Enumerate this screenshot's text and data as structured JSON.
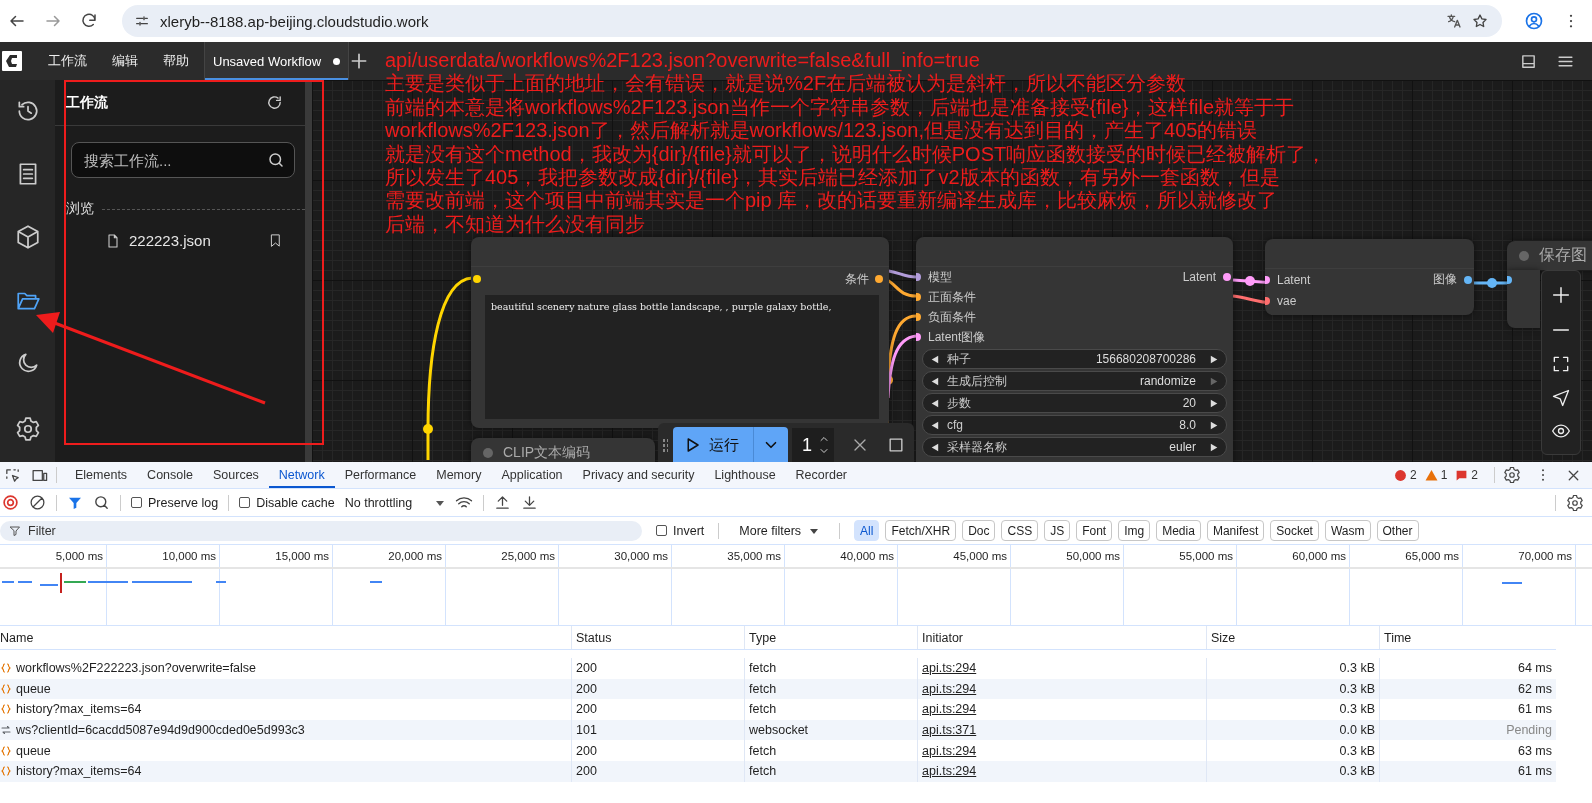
{
  "browser": {
    "url": "xleryb--8188.ap-beijing.cloudstudio.work"
  },
  "menubar": {
    "menus": [
      "工作流",
      "编辑",
      "帮助"
    ],
    "tabs": [
      {
        "label": "Unsaved Workflow",
        "selected": true,
        "unsaved": true
      }
    ]
  },
  "side_nav": [
    {
      "kind": "history",
      "selected": false
    },
    {
      "kind": "queue",
      "selected": false
    },
    {
      "kind": "models",
      "selected": false
    },
    {
      "kind": "workflows",
      "selected": true
    },
    {
      "kind": "theme",
      "selected": false
    },
    {
      "kind": "settings",
      "selected": false
    }
  ],
  "sidebar": {
    "title": "工作流",
    "search": {
      "placeholder": "搜索工作流..."
    },
    "section": "浏览",
    "files": [
      {
        "name": "222223.json"
      }
    ]
  },
  "annotation": {
    "lines": [
      "api/userdata/workflows%2F123.json?overwrite=false&full_info=true",
      "主要是类似于上面的地址，会有错误，就是说%2F在后端被认为是斜杆，所以不能区分参数",
      "前端的本意是将workflows%2F123.json当作一个字符串参数，后端也是准备接受{file}，这样file就等于于",
      "workflows%2F123.json了，然后解析就是workflows/123.json,但是没有达到目的，产生了405的错误",
      "就是没有这个method，我改为{dir}/{file}就可以了，说明什么时候POST响应函数接受的时候已经被解析了，",
      "所以发生了405，我把参数改成{dir}/{file}，其实后端已经添加了v2版本的函数，有另外一套函数，但是",
      "需要改前端，这个项目中前端其实是一个pip 库，改的话要重新编译生成库，比较麻烦，所以就修改了",
      "后端，不知道为什么没有同步"
    ]
  },
  "nodes": {
    "clip_encode": {
      "inputs": [
        {
          "color": "#ffd500"
        }
      ],
      "output": {
        "label": "条件",
        "color": "#ffa931"
      },
      "prompt": "beautiful scenery nature glass bottle landscape, , purple galaxy bottle,"
    },
    "clip_encode_2": {
      "title": "CLIP文本编码"
    },
    "ksampler": {
      "inputs": [
        {
          "label": "模型",
          "color": "#b39ddb"
        },
        {
          "label": "正面条件",
          "color": "#ffa931"
        },
        {
          "label": "负面条件",
          "color": "#ffa931"
        },
        {
          "label": "Latent图像",
          "color": "#ff9cf9"
        }
      ],
      "output": {
        "label": "Latent",
        "color": "#ff9cf9"
      },
      "widgets": [
        {
          "label": "种子",
          "value": "156680208700286",
          "disabled": false
        },
        {
          "label": "生成后控制",
          "value": "randomize",
          "disabled": true
        },
        {
          "label": "步数",
          "value": "20",
          "disabled": false
        },
        {
          "label": "cfg",
          "value": "8.0",
          "disabled": false
        },
        {
          "label": "采样器名称",
          "value": "euler",
          "disabled": false
        }
      ]
    },
    "vae_decode": {
      "inputs": [
        {
          "label": "Latent",
          "color": "#ff9cf9"
        },
        {
          "label": "vae",
          "color": "#ff6e6e"
        }
      ],
      "output": {
        "label": "图像",
        "color": "#64b5f6"
      }
    },
    "save_image": {
      "title": "保存图",
      "inputs": [
        {
          "color": "#64b5f6"
        }
      ]
    }
  },
  "run_toolbar": {
    "label": "运行",
    "queue_count": "1"
  },
  "devtools": {
    "tabs": [
      {
        "label": "Elements",
        "selected": false
      },
      {
        "label": "Console",
        "selected": false
      },
      {
        "label": "Sources",
        "selected": false
      },
      {
        "label": "Network",
        "selected": true
      },
      {
        "label": "Performance",
        "selected": false
      },
      {
        "label": "Memory",
        "selected": false
      },
      {
        "label": "Application",
        "selected": false
      },
      {
        "label": "Privacy and security",
        "selected": false
      },
      {
        "label": "Lighthouse",
        "selected": false
      },
      {
        "label": "Recorder",
        "selected": false
      }
    ],
    "counts": {
      "errors": "2",
      "warnings": "1",
      "issues": "2"
    },
    "preserve_log": {
      "label": "Preserve log",
      "checked": false
    },
    "disable_cache": {
      "label": "Disable cache",
      "checked": false
    },
    "throttling": "No throttling",
    "filter": {
      "placeholder": "Filter",
      "invert": {
        "label": "Invert",
        "checked": false
      },
      "more_filters": "More filters",
      "types": [
        {
          "label": "All",
          "selected": true
        },
        {
          "label": "Fetch/XHR",
          "selected": false
        },
        {
          "label": "Doc",
          "selected": false
        },
        {
          "label": "CSS",
          "selected": false
        },
        {
          "label": "JS",
          "selected": false
        },
        {
          "label": "Font",
          "selected": false
        },
        {
          "label": "Img",
          "selected": false
        },
        {
          "label": "Media",
          "selected": false
        },
        {
          "label": "Manifest",
          "selected": false
        },
        {
          "label": "Socket",
          "selected": false
        },
        {
          "label": "Wasm",
          "selected": false
        },
        {
          "label": "Other",
          "selected": false
        }
      ]
    },
    "timeline_ticks": [
      "5,000 ms",
      "10,000 ms",
      "15,000 ms",
      "20,000 ms",
      "25,000 ms",
      "30,000 ms",
      "35,000 ms",
      "40,000 ms",
      "45,000 ms",
      "50,000 ms",
      "55,000 ms",
      "60,000 ms",
      "65,000 ms",
      "70,000 ms"
    ],
    "table": {
      "columns": [
        "Name",
        "Status",
        "Type",
        "Initiator",
        "Size",
        "Time"
      ],
      "rows": [
        {
          "kind": "fetch",
          "name": "workflows%2F222223.json?overwrite=false",
          "status": "200",
          "type": "fetch",
          "initiator": "api.ts:294",
          "size": "0.3 kB",
          "time": "64 ms",
          "pending": false
        },
        {
          "kind": "fetch",
          "name": "queue",
          "status": "200",
          "type": "fetch",
          "initiator": "api.ts:294",
          "size": "0.3 kB",
          "time": "62 ms",
          "pending": false
        },
        {
          "kind": "fetch",
          "name": "history?max_items=64",
          "status": "200",
          "type": "fetch",
          "initiator": "api.ts:294",
          "size": "0.3 kB",
          "time": "61 ms",
          "pending": false
        },
        {
          "kind": "websocket",
          "name": "ws?clientId=6cacdd5087e94d9d900cded0e5d993c3",
          "status": "101",
          "type": "websocket",
          "initiator": "api.ts:371",
          "size": "0.0 kB",
          "time": "Pending",
          "pending": true
        },
        {
          "kind": "fetch",
          "name": "queue",
          "status": "200",
          "type": "fetch",
          "initiator": "api.ts:294",
          "size": "0.3 kB",
          "time": "63 ms",
          "pending": false
        },
        {
          "kind": "fetch",
          "name": "history?max_items=64",
          "status": "200",
          "type": "fetch",
          "initiator": "api.ts:294",
          "size": "0.3 kB",
          "time": "61 ms",
          "pending": false
        }
      ]
    }
  }
}
